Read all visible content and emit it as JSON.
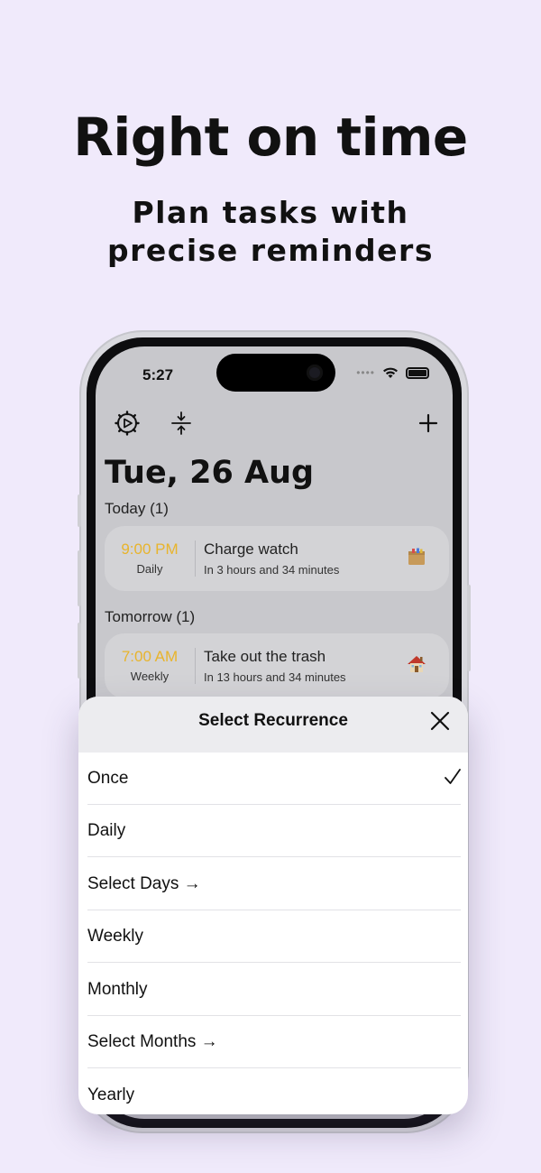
{
  "marketing": {
    "headline": "Right on time",
    "subline_1": "Plan tasks with",
    "subline_2": "precise reminders"
  },
  "status_bar": {
    "time": "5:27",
    "signal": "••••"
  },
  "toolbar": {
    "left_icons": [
      "timer-settings-icon",
      "collapse-icon"
    ],
    "right_icon": "plus-icon"
  },
  "header": {
    "date": "Tue, 26 Aug"
  },
  "sections": [
    {
      "label": "Today (1)",
      "tasks": [
        {
          "time": "9:00 PM",
          "recurrence": "Daily",
          "title": "Charge watch",
          "subtitle": "In 3 hours and 34 minutes",
          "icon": "package-icon"
        }
      ]
    },
    {
      "label": "Tomorrow (1)",
      "tasks": [
        {
          "time": "7:00 AM",
          "recurrence": "Weekly",
          "title": "Take out the trash",
          "subtitle": "In 13 hours and 34 minutes",
          "icon": "house-icon"
        }
      ]
    }
  ],
  "sheet": {
    "title": "Select Recurrence",
    "close_icon": "close-icon",
    "selected": "Once",
    "options": [
      "Once",
      "Daily",
      "Select Days →",
      "Weekly",
      "Monthly",
      "Select Months →",
      "Yearly"
    ]
  },
  "colors": {
    "background": "#f0eafb",
    "accent_time": "#e8b42c"
  }
}
